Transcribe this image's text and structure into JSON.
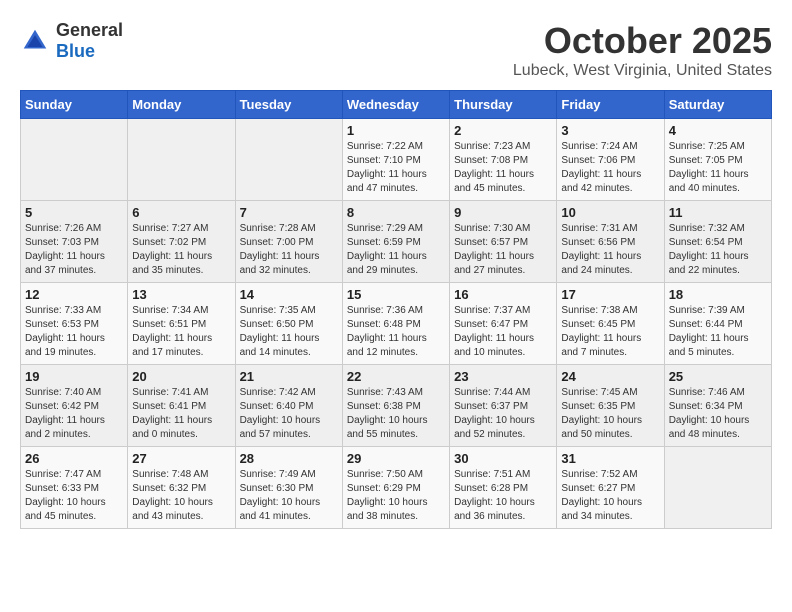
{
  "header": {
    "logo_general": "General",
    "logo_blue": "Blue",
    "month": "October 2025",
    "location": "Lubeck, West Virginia, United States"
  },
  "days_of_week": [
    "Sunday",
    "Monday",
    "Tuesday",
    "Wednesday",
    "Thursday",
    "Friday",
    "Saturday"
  ],
  "weeks": [
    [
      {
        "day": "",
        "info": ""
      },
      {
        "day": "",
        "info": ""
      },
      {
        "day": "",
        "info": ""
      },
      {
        "day": "1",
        "info": "Sunrise: 7:22 AM\nSunset: 7:10 PM\nDaylight: 11 hours and 47 minutes."
      },
      {
        "day": "2",
        "info": "Sunrise: 7:23 AM\nSunset: 7:08 PM\nDaylight: 11 hours and 45 minutes."
      },
      {
        "day": "3",
        "info": "Sunrise: 7:24 AM\nSunset: 7:06 PM\nDaylight: 11 hours and 42 minutes."
      },
      {
        "day": "4",
        "info": "Sunrise: 7:25 AM\nSunset: 7:05 PM\nDaylight: 11 hours and 40 minutes."
      }
    ],
    [
      {
        "day": "5",
        "info": "Sunrise: 7:26 AM\nSunset: 7:03 PM\nDaylight: 11 hours and 37 minutes."
      },
      {
        "day": "6",
        "info": "Sunrise: 7:27 AM\nSunset: 7:02 PM\nDaylight: 11 hours and 35 minutes."
      },
      {
        "day": "7",
        "info": "Sunrise: 7:28 AM\nSunset: 7:00 PM\nDaylight: 11 hours and 32 minutes."
      },
      {
        "day": "8",
        "info": "Sunrise: 7:29 AM\nSunset: 6:59 PM\nDaylight: 11 hours and 29 minutes."
      },
      {
        "day": "9",
        "info": "Sunrise: 7:30 AM\nSunset: 6:57 PM\nDaylight: 11 hours and 27 minutes."
      },
      {
        "day": "10",
        "info": "Sunrise: 7:31 AM\nSunset: 6:56 PM\nDaylight: 11 hours and 24 minutes."
      },
      {
        "day": "11",
        "info": "Sunrise: 7:32 AM\nSunset: 6:54 PM\nDaylight: 11 hours and 22 minutes."
      }
    ],
    [
      {
        "day": "12",
        "info": "Sunrise: 7:33 AM\nSunset: 6:53 PM\nDaylight: 11 hours and 19 minutes."
      },
      {
        "day": "13",
        "info": "Sunrise: 7:34 AM\nSunset: 6:51 PM\nDaylight: 11 hours and 17 minutes."
      },
      {
        "day": "14",
        "info": "Sunrise: 7:35 AM\nSunset: 6:50 PM\nDaylight: 11 hours and 14 minutes."
      },
      {
        "day": "15",
        "info": "Sunrise: 7:36 AM\nSunset: 6:48 PM\nDaylight: 11 hours and 12 minutes."
      },
      {
        "day": "16",
        "info": "Sunrise: 7:37 AM\nSunset: 6:47 PM\nDaylight: 11 hours and 10 minutes."
      },
      {
        "day": "17",
        "info": "Sunrise: 7:38 AM\nSunset: 6:45 PM\nDaylight: 11 hours and 7 minutes."
      },
      {
        "day": "18",
        "info": "Sunrise: 7:39 AM\nSunset: 6:44 PM\nDaylight: 11 hours and 5 minutes."
      }
    ],
    [
      {
        "day": "19",
        "info": "Sunrise: 7:40 AM\nSunset: 6:42 PM\nDaylight: 11 hours and 2 minutes."
      },
      {
        "day": "20",
        "info": "Sunrise: 7:41 AM\nSunset: 6:41 PM\nDaylight: 11 hours and 0 minutes."
      },
      {
        "day": "21",
        "info": "Sunrise: 7:42 AM\nSunset: 6:40 PM\nDaylight: 10 hours and 57 minutes."
      },
      {
        "day": "22",
        "info": "Sunrise: 7:43 AM\nSunset: 6:38 PM\nDaylight: 10 hours and 55 minutes."
      },
      {
        "day": "23",
        "info": "Sunrise: 7:44 AM\nSunset: 6:37 PM\nDaylight: 10 hours and 52 minutes."
      },
      {
        "day": "24",
        "info": "Sunrise: 7:45 AM\nSunset: 6:35 PM\nDaylight: 10 hours and 50 minutes."
      },
      {
        "day": "25",
        "info": "Sunrise: 7:46 AM\nSunset: 6:34 PM\nDaylight: 10 hours and 48 minutes."
      }
    ],
    [
      {
        "day": "26",
        "info": "Sunrise: 7:47 AM\nSunset: 6:33 PM\nDaylight: 10 hours and 45 minutes."
      },
      {
        "day": "27",
        "info": "Sunrise: 7:48 AM\nSunset: 6:32 PM\nDaylight: 10 hours and 43 minutes."
      },
      {
        "day": "28",
        "info": "Sunrise: 7:49 AM\nSunset: 6:30 PM\nDaylight: 10 hours and 41 minutes."
      },
      {
        "day": "29",
        "info": "Sunrise: 7:50 AM\nSunset: 6:29 PM\nDaylight: 10 hours and 38 minutes."
      },
      {
        "day": "30",
        "info": "Sunrise: 7:51 AM\nSunset: 6:28 PM\nDaylight: 10 hours and 36 minutes."
      },
      {
        "day": "31",
        "info": "Sunrise: 7:52 AM\nSunset: 6:27 PM\nDaylight: 10 hours and 34 minutes."
      },
      {
        "day": "",
        "info": ""
      }
    ]
  ]
}
